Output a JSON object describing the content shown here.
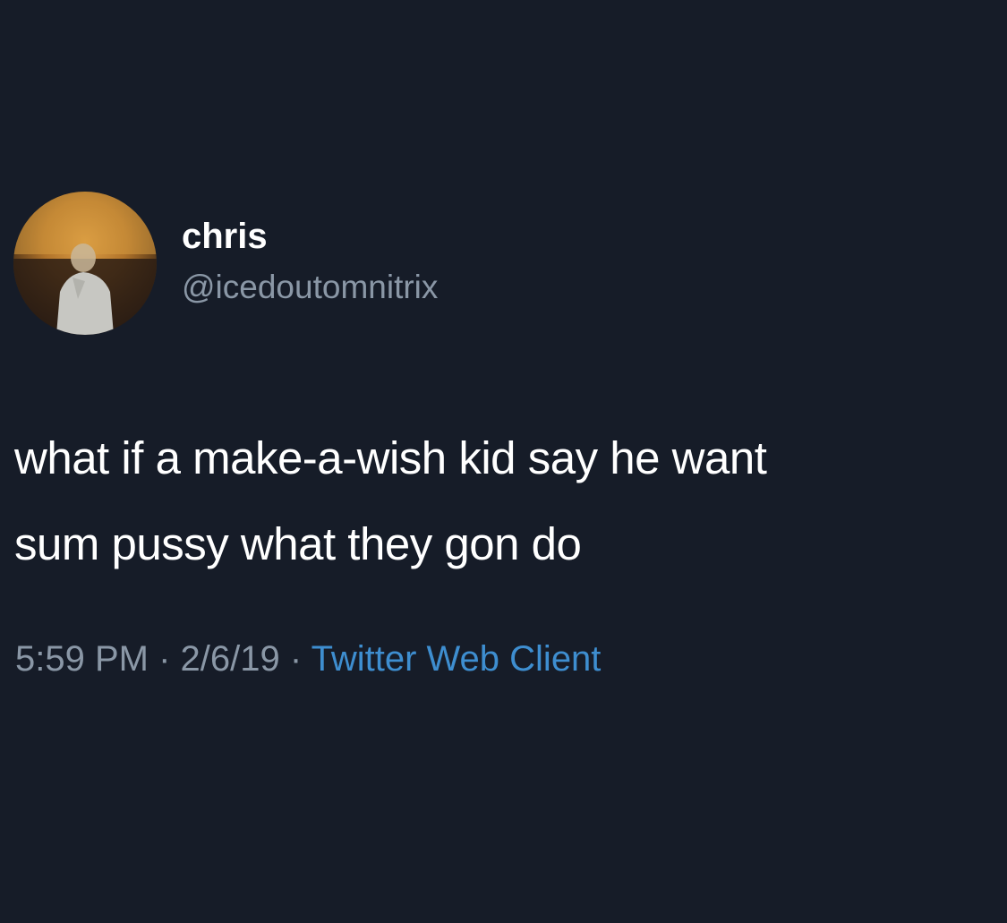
{
  "tweet": {
    "author": {
      "display_name": "chris",
      "handle": "@icedoutomnitrix"
    },
    "text_lines": [
      "what if a make-a-wish kid say he want",
      "sum pussy what they gon do"
    ],
    "meta": {
      "time": "5:59 PM",
      "separator": "·",
      "date": "2/6/19",
      "source": "Twitter Web Client"
    }
  },
  "colors": {
    "background": "#161c28",
    "text_primary": "#ffffff",
    "text_secondary": "#8a97a6",
    "link": "#3e8ed0"
  }
}
